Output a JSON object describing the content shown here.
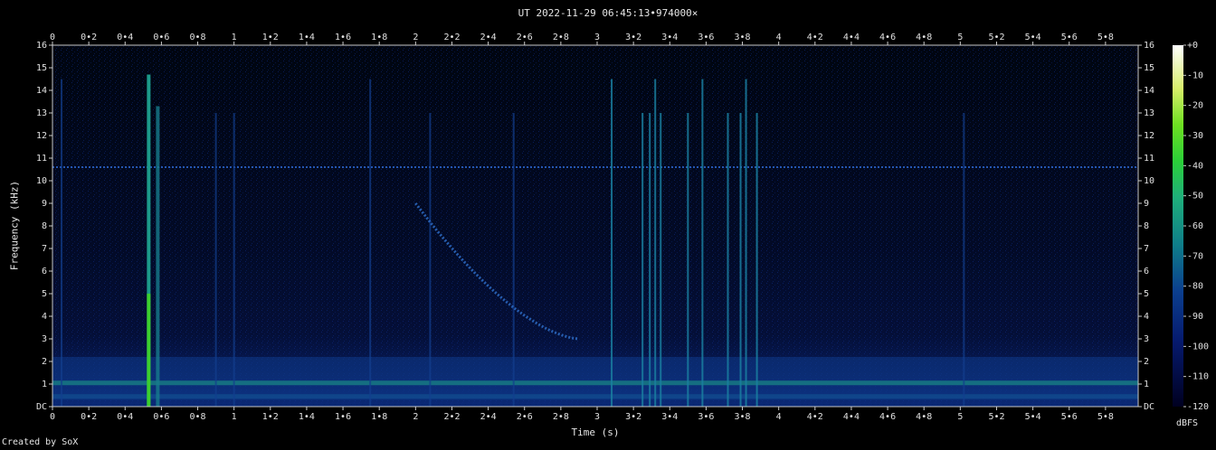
{
  "chart_data": {
    "type": "heatmap",
    "title": "UT 2022-11-29 06:45:13•974000×",
    "xlabel": "Time (s)",
    "ylabel": "Frequency (kHz)",
    "xlim": [
      0,
      5.98
    ],
    "ylim": [
      0,
      16
    ],
    "x_ticks": [
      "0",
      "0•2",
      "0•4",
      "0•6",
      "0•8",
      "1",
      "1•2",
      "1•4",
      "1•6",
      "1•8",
      "2",
      "2•2",
      "2•4",
      "2•6",
      "2•8",
      "3",
      "3•2",
      "3•4",
      "3•6",
      "3•8",
      "4",
      "4•2",
      "4•4",
      "4•6",
      "4•8",
      "5",
      "5•2",
      "5•4",
      "5•6",
      "5•8"
    ],
    "y_ticks": [
      "DC",
      "1",
      "2",
      "3",
      "4",
      "5",
      "6",
      "7",
      "8",
      "9",
      "10",
      "11",
      "12",
      "13",
      "14",
      "15",
      "16"
    ],
    "colorbar": {
      "label": "dBFS",
      "ticks": [
        "+0",
        "-10",
        "-20",
        "-30",
        "-40",
        "-50",
        "-60",
        "-70",
        "-80",
        "-90",
        "-100",
        "-110",
        "-120"
      ],
      "range": [
        -120,
        0
      ]
    },
    "features": {
      "horizontal_tone_khz": 10.6,
      "low_band_khz": [
        0.3,
        2.2
      ],
      "strong_impulse_s": 0.53,
      "impulses_s": [
        0.05,
        0.9,
        1.0,
        1.75,
        2.08,
        2.54,
        3.08,
        3.25,
        3.29,
        3.32,
        3.35,
        3.5,
        3.58,
        3.72,
        3.79,
        3.82,
        3.88,
        5.02
      ],
      "whistler": {
        "start_s": 2.0,
        "start_khz": 9.0,
        "end_s": 2.9,
        "end_khz": 3.0
      }
    }
  },
  "footer": {
    "credit": "Created by SoX"
  }
}
